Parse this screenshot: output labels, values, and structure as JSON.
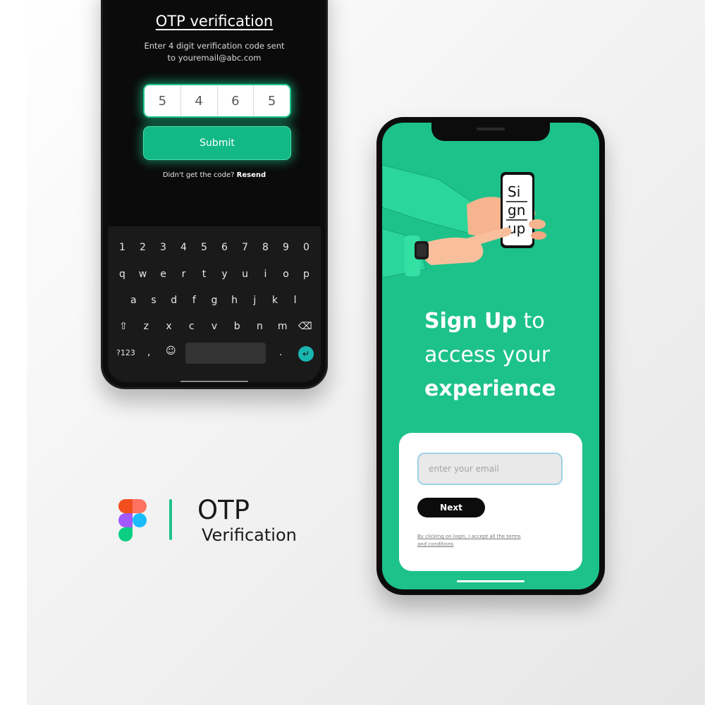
{
  "otp_screen": {
    "title": "OTP verification",
    "subtitle_line1": "Enter 4 digit verification code sent",
    "subtitle_line2": "to  youremail@abc.com",
    "digits": [
      "5",
      "4",
      "6",
      "5"
    ],
    "submit_label": "Submit",
    "resend_prompt": "Didn't get the code?",
    "resend_label": "Resend",
    "accent_color": "#12b886"
  },
  "keyboard": {
    "row1": [
      "1",
      "2",
      "3",
      "4",
      "5",
      "6",
      "7",
      "8",
      "9",
      "0"
    ],
    "row2": [
      "q",
      "w",
      "e",
      "r",
      "t",
      "y",
      "u",
      "i",
      "o",
      "p"
    ],
    "row3": [
      "a",
      "s",
      "d",
      "f",
      "g",
      "h",
      "j",
      "k",
      "l"
    ],
    "row4": [
      "⇧",
      "z",
      "x",
      "c",
      "v",
      "b",
      "n",
      "m",
      "⌫"
    ],
    "symbols_key": "?123",
    "comma_key": ",",
    "emoji_key": "☺",
    "period_key": ".",
    "enter_key": "↵"
  },
  "signup_screen": {
    "illustration_text": [
      "Si",
      "gn",
      "up"
    ],
    "headline_bold1": "Sign Up",
    "headline_rest1": " to",
    "headline_line2": "access your",
    "headline_bold2": "experience",
    "email_placeholder": "enter your email",
    "next_label": "Next",
    "terms_text": "By clicking on login, I accept all the terms and conditions",
    "background_color": "#1dc28a"
  },
  "branding": {
    "logo_icon": "figma-logo",
    "title": "OTP",
    "subtitle": "Verification",
    "divider_color": "#1dc28a"
  }
}
